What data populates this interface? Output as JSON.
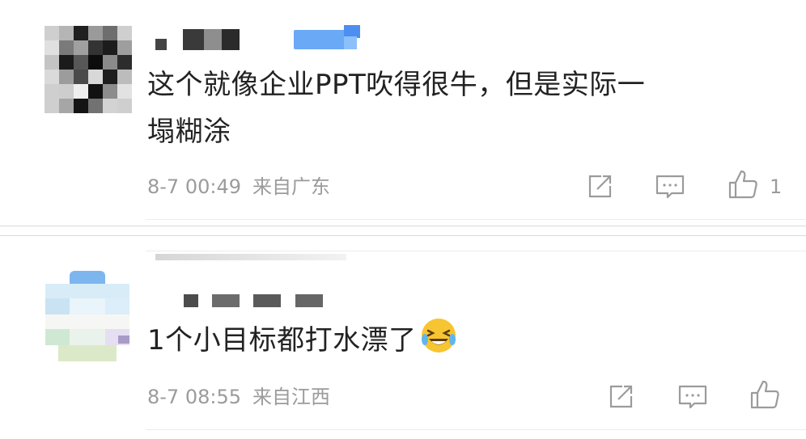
{
  "comments": [
    {
      "text": "这个就像企业PPT吹得很牛，但是实际一塌糊涂",
      "line1": "这个就像企业PPT吹得很牛，但是实际一",
      "line2": "塌糊涂",
      "date": "8-7 00:49",
      "location": "来自广东",
      "like_count": "1"
    },
    {
      "text": "1个小目标都打水漂了",
      "date": "8-7 08:55",
      "location": "来自江西",
      "emoji": "grinning-squinting-with-tears-icon"
    }
  ],
  "icons": {
    "share": "share-icon",
    "comment": "comment-icon",
    "like": "thumbs-up-icon"
  },
  "colors": {
    "text": "#222222",
    "meta": "#9b9b9b",
    "verified_badge": "#6aa9f5"
  }
}
